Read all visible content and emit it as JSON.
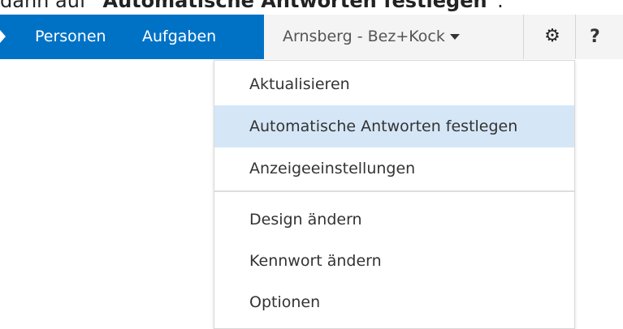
{
  "caption": {
    "prefix": "dann auf ",
    "emphasis": "\"Automatische Antworten festlegen\"",
    "suffix": "."
  },
  "topbar": {
    "nav": [
      {
        "label": "Personen"
      },
      {
        "label": "Aufgaben"
      }
    ],
    "account": {
      "label": "Arnsberg - Bez+Kock"
    },
    "help_label": "?",
    "colors": {
      "brand": "#0072c6",
      "bar": "#f4f4f4",
      "highlight": "#d5e7f7"
    }
  },
  "menu": {
    "items": [
      {
        "label": "Aktualisieren"
      },
      {
        "label": "Automatische Antworten festlegen",
        "highlighted": true
      },
      {
        "label": "Anzeigeeinstellungen"
      },
      {
        "label": "Design ändern"
      },
      {
        "label": "Kennwort ändern"
      },
      {
        "label": "Optionen"
      }
    ]
  }
}
